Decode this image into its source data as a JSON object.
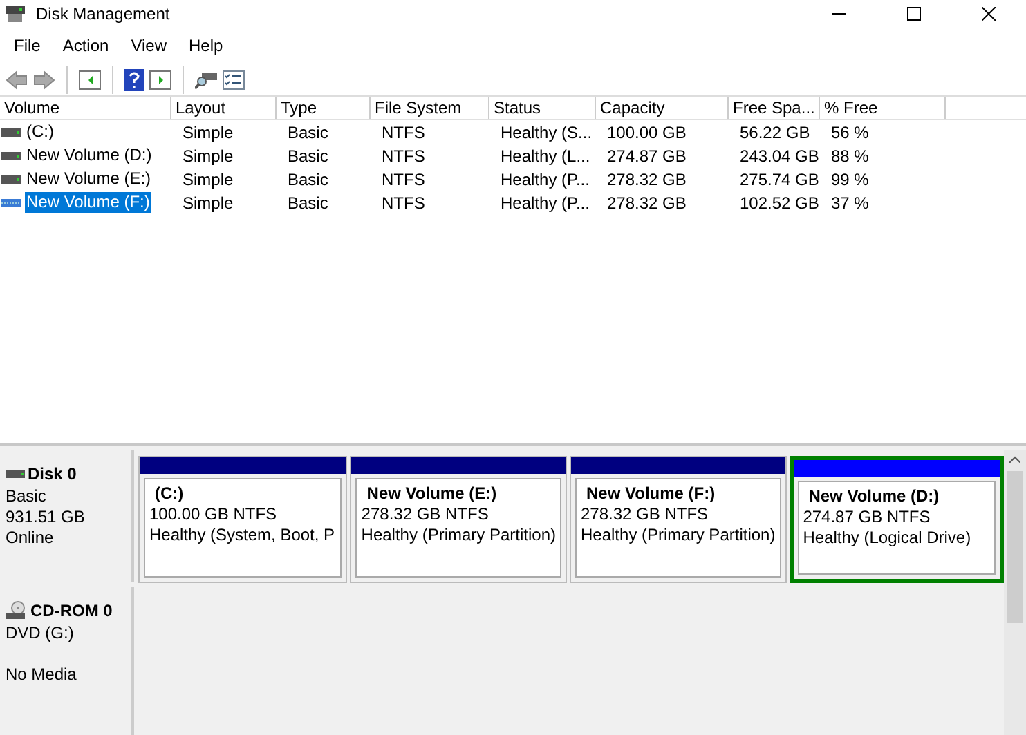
{
  "window": {
    "title": "Disk Management"
  },
  "menu": [
    "File",
    "Action",
    "View",
    "Help"
  ],
  "table": {
    "columns": [
      "Volume",
      "Layout",
      "Type",
      "File System",
      "Status",
      "Capacity",
      "Free Spa...",
      "% Free"
    ],
    "rows": [
      {
        "selected": false,
        "kind": "disk",
        "cells": [
          "(C:)",
          "Simple",
          "Basic",
          "NTFS",
          "Healthy (S...",
          "100.00 GB",
          "56.22 GB",
          "56 %"
        ]
      },
      {
        "selected": false,
        "kind": "disk",
        "cells": [
          "New Volume (D:)",
          "Simple",
          "Basic",
          "NTFS",
          "Healthy (L...",
          "274.87 GB",
          "243.04 GB",
          "88 %"
        ]
      },
      {
        "selected": false,
        "kind": "disk",
        "cells": [
          "New Volume (E:)",
          "Simple",
          "Basic",
          "NTFS",
          "Healthy (P...",
          "278.32 GB",
          "275.74 GB",
          "99 %"
        ]
      },
      {
        "selected": true,
        "kind": "striped",
        "cells": [
          "New Volume (F:)",
          "Simple",
          "Basic",
          "NTFS",
          "Healthy (P...",
          "278.32 GB",
          "102.52 GB",
          "37 %"
        ]
      }
    ]
  },
  "disks": [
    {
      "kind": "disk",
      "name": "Disk 0",
      "lines": [
        "Basic",
        "931.51 GB"
      ],
      "status": "Online",
      "partitions": [
        {
          "name": "(C:)",
          "size": "100.00 GB NTFS",
          "status": "Healthy (System, Boot, P",
          "color": "#000080",
          "selected": false
        },
        {
          "name": "New Volume  (E:)",
          "size": "278.32 GB NTFS",
          "status": "Healthy (Primary Partition)",
          "color": "#000080",
          "selected": false
        },
        {
          "name": "New Volume  (F:)",
          "size": "278.32 GB NTFS",
          "status": "Healthy (Primary Partition)",
          "color": "#000080",
          "selected": false
        },
        {
          "name": "New Volume  (D:)",
          "size": "274.87 GB NTFS",
          "status": "Healthy (Logical Drive)",
          "color": "#0000ff",
          "selected": true
        }
      ]
    },
    {
      "kind": "cdrom",
      "name": "CD-ROM 0",
      "lines": [
        "DVD (G:)"
      ],
      "status": "No Media"
    }
  ]
}
